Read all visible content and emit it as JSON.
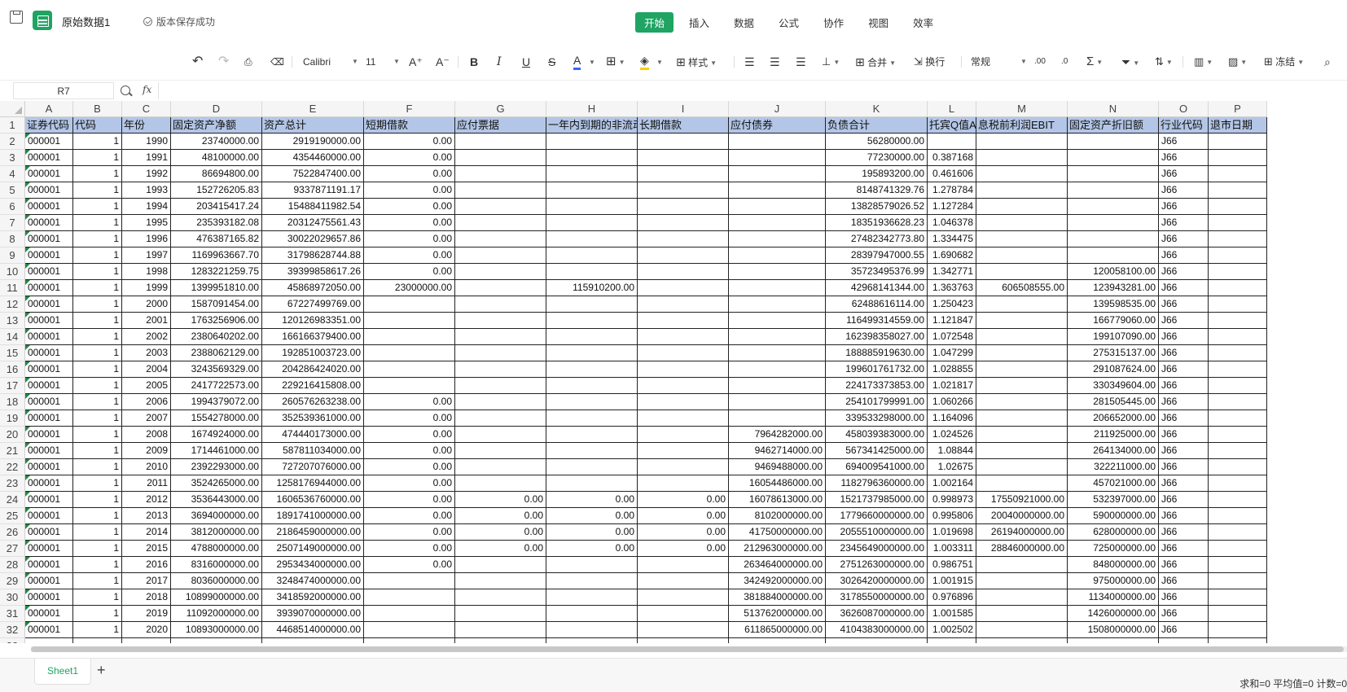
{
  "titlebar": {
    "doc_title": "原始数据1",
    "save_status": "版本保存成功",
    "menu_tabs": [
      "开始",
      "插入",
      "数据",
      "公式",
      "协作",
      "视图",
      "效率"
    ],
    "active_tab": "开始"
  },
  "toolbar": {
    "font_name": "Calibri",
    "font_size": "11",
    "bold": "B",
    "italic": "I",
    "underline": "U",
    "strike": "S",
    "font_color": "A",
    "style_label": "样式",
    "merge_label": "合并",
    "wrap_label": "换行",
    "number_format": "常规",
    "freeze_label": "冻结",
    "icons": [
      "undo-icon",
      "redo-icon",
      "format-painter-icon",
      "eraser-icon",
      "increase-font-icon",
      "decrease-font-icon",
      "border-icon",
      "fill-color-icon",
      "align-left-icon",
      "align-center-icon",
      "align-right-icon",
      "valign-icon",
      "increase-decimal-icon",
      "decrease-decimal-icon",
      "sum-icon",
      "filter-icon",
      "sort-icon",
      "chart-icon",
      "image-icon",
      "search-icon"
    ]
  },
  "formula_bar": {
    "name_box": "R7",
    "fx": "fx",
    "value": ""
  },
  "grid": {
    "columns": [
      "A",
      "B",
      "C",
      "D",
      "E",
      "F",
      "G",
      "H",
      "I",
      "J",
      "K",
      "L",
      "M",
      "N",
      "O",
      "P"
    ],
    "row_numbers": [
      "1",
      "2",
      "3",
      "4",
      "5",
      "6",
      "7",
      "8",
      "9",
      "10",
      "11",
      "12",
      "13",
      "14",
      "15",
      "16",
      "17",
      "18",
      "19",
      "20",
      "21",
      "22",
      "23",
      "24",
      "25",
      "26",
      "27",
      "28",
      "29",
      "30",
      "31",
      "32",
      "33"
    ],
    "header_row": [
      "证券代码",
      "代码",
      "年份",
      "固定资产净额",
      "资产总计",
      "短期借款",
      "应付票据",
      "一年内到期的非流动负债",
      "长期借款",
      "应付债券",
      "负债合计",
      "托宾Q值A",
      "息税前利润EBIT",
      "固定资产折旧额",
      "行业代码",
      "退市日期"
    ],
    "data_rows": [
      [
        "000001",
        "1",
        "1990",
        "23740000.00",
        "2919190000.00",
        "0.00",
        "",
        "",
        "",
        "",
        "56280000.00",
        "",
        "",
        "",
        "J66",
        ""
      ],
      [
        "000001",
        "1",
        "1991",
        "48100000.00",
        "4354460000.00",
        "0.00",
        "",
        "",
        "",
        "",
        "77230000.00",
        "0.387168",
        "",
        "",
        "J66",
        ""
      ],
      [
        "000001",
        "1",
        "1992",
        "86694800.00",
        "7522847400.00",
        "0.00",
        "",
        "",
        "",
        "",
        "195893200.00",
        "0.461606",
        "",
        "",
        "J66",
        ""
      ],
      [
        "000001",
        "1",
        "1993",
        "152726205.83",
        "9337871191.17",
        "0.00",
        "",
        "",
        "",
        "",
        "8148741329.76",
        "1.278784",
        "",
        "",
        "J66",
        ""
      ],
      [
        "000001",
        "1",
        "1994",
        "203415417.24",
        "15488411982.54",
        "0.00",
        "",
        "",
        "",
        "",
        "13828579026.52",
        "1.127284",
        "",
        "",
        "J66",
        ""
      ],
      [
        "000001",
        "1",
        "1995",
        "235393182.08",
        "20312475561.43",
        "0.00",
        "",
        "",
        "",
        "",
        "18351936628.23",
        "1.046378",
        "",
        "",
        "J66",
        ""
      ],
      [
        "000001",
        "1",
        "1996",
        "476387165.82",
        "30022029657.86",
        "0.00",
        "",
        "",
        "",
        "",
        "27482342773.80",
        "1.334475",
        "",
        "",
        "J66",
        ""
      ],
      [
        "000001",
        "1",
        "1997",
        "1169963667.70",
        "31798628744.88",
        "0.00",
        "",
        "",
        "",
        "",
        "28397947000.55",
        "1.690682",
        "",
        "",
        "J66",
        ""
      ],
      [
        "000001",
        "1",
        "1998",
        "1283221259.75",
        "39399858617.26",
        "0.00",
        "",
        "",
        "",
        "",
        "35723495376.99",
        "1.342771",
        "",
        "120058100.00",
        "J66",
        ""
      ],
      [
        "000001",
        "1",
        "1999",
        "1399951810.00",
        "45868972050.00",
        "23000000.00",
        "",
        "115910200.00",
        "",
        "",
        "42968141344.00",
        "1.363763",
        "606508555.00",
        "123943281.00",
        "J66",
        ""
      ],
      [
        "000001",
        "1",
        "2000",
        "1587091454.00",
        "67227499769.00",
        "",
        "",
        "",
        "",
        "",
        "62488616114.00",
        "1.250423",
        "",
        "139598535.00",
        "J66",
        ""
      ],
      [
        "000001",
        "1",
        "2001",
        "1763256906.00",
        "120126983351.00",
        "",
        "",
        "",
        "",
        "",
        "116499314559.00",
        "1.121847",
        "",
        "166779060.00",
        "J66",
        ""
      ],
      [
        "000001",
        "1",
        "2002",
        "2380640202.00",
        "166166379400.00",
        "",
        "",
        "",
        "",
        "",
        "162398358027.00",
        "1.072548",
        "",
        "199107090.00",
        "J66",
        ""
      ],
      [
        "000001",
        "1",
        "2003",
        "2388062129.00",
        "192851003723.00",
        "",
        "",
        "",
        "",
        "",
        "188885919630.00",
        "1.047299",
        "",
        "275315137.00",
        "J66",
        ""
      ],
      [
        "000001",
        "1",
        "2004",
        "3243569329.00",
        "204286424020.00",
        "",
        "",
        "",
        "",
        "",
        "199601761732.00",
        "1.028855",
        "",
        "291087624.00",
        "J66",
        ""
      ],
      [
        "000001",
        "1",
        "2005",
        "2417722573.00",
        "229216415808.00",
        "",
        "",
        "",
        "",
        "",
        "224173373853.00",
        "1.021817",
        "",
        "330349604.00",
        "J66",
        ""
      ],
      [
        "000001",
        "1",
        "2006",
        "1994379072.00",
        "260576263238.00",
        "0.00",
        "",
        "",
        "",
        "",
        "254101799991.00",
        "1.060266",
        "",
        "281505445.00",
        "J66",
        ""
      ],
      [
        "000001",
        "1",
        "2007",
        "1554278000.00",
        "352539361000.00",
        "0.00",
        "",
        "",
        "",
        "",
        "339533298000.00",
        "1.164096",
        "",
        "206652000.00",
        "J66",
        ""
      ],
      [
        "000001",
        "1",
        "2008",
        "1674924000.00",
        "474440173000.00",
        "0.00",
        "",
        "",
        "",
        "7964282000.00",
        "458039383000.00",
        "1.024526",
        "",
        "211925000.00",
        "J66",
        ""
      ],
      [
        "000001",
        "1",
        "2009",
        "1714461000.00",
        "587811034000.00",
        "0.00",
        "",
        "",
        "",
        "9462714000.00",
        "567341425000.00",
        "1.08844",
        "",
        "264134000.00",
        "J66",
        ""
      ],
      [
        "000001",
        "1",
        "2010",
        "2392293000.00",
        "727207076000.00",
        "0.00",
        "",
        "",
        "",
        "9469488000.00",
        "694009541000.00",
        "1.02675",
        "",
        "322211000.00",
        "J66",
        ""
      ],
      [
        "000001",
        "1",
        "2011",
        "3524265000.00",
        "1258176944000.00",
        "0.00",
        "",
        "",
        "",
        "16054486000.00",
        "1182796360000.00",
        "1.002164",
        "",
        "457021000.00",
        "J66",
        ""
      ],
      [
        "000001",
        "1",
        "2012",
        "3536443000.00",
        "1606536760000.00",
        "0.00",
        "0.00",
        "0.00",
        "0.00",
        "16078613000.00",
        "1521737985000.00",
        "0.998973",
        "17550921000.00",
        "532397000.00",
        "J66",
        ""
      ],
      [
        "000001",
        "1",
        "2013",
        "3694000000.00",
        "1891741000000.00",
        "0.00",
        "0.00",
        "0.00",
        "0.00",
        "8102000000.00",
        "1779660000000.00",
        "0.995806",
        "20040000000.00",
        "590000000.00",
        "J66",
        ""
      ],
      [
        "000001",
        "1",
        "2014",
        "3812000000.00",
        "2186459000000.00",
        "0.00",
        "0.00",
        "0.00",
        "0.00",
        "41750000000.00",
        "2055510000000.00",
        "1.019698",
        "26194000000.00",
        "628000000.00",
        "J66",
        ""
      ],
      [
        "000001",
        "1",
        "2015",
        "4788000000.00",
        "2507149000000.00",
        "0.00",
        "0.00",
        "0.00",
        "0.00",
        "212963000000.00",
        "2345649000000.00",
        "1.003311",
        "28846000000.00",
        "725000000.00",
        "J66",
        ""
      ],
      [
        "000001",
        "1",
        "2016",
        "8316000000.00",
        "2953434000000.00",
        "0.00",
        "",
        "",
        "",
        "263464000000.00",
        "2751263000000.00",
        "0.986751",
        "",
        "848000000.00",
        "J66",
        ""
      ],
      [
        "000001",
        "1",
        "2017",
        "8036000000.00",
        "3248474000000.00",
        "",
        "",
        "",
        "",
        "342492000000.00",
        "3026420000000.00",
        "1.001915",
        "",
        "975000000.00",
        "J66",
        ""
      ],
      [
        "000001",
        "1",
        "2018",
        "10899000000.00",
        "3418592000000.00",
        "",
        "",
        "",
        "",
        "381884000000.00",
        "3178550000000.00",
        "0.976896",
        "",
        "1134000000.00",
        "J66",
        ""
      ],
      [
        "000001",
        "1",
        "2019",
        "11092000000.00",
        "3939070000000.00",
        "",
        "",
        "",
        "",
        "513762000000.00",
        "3626087000000.00",
        "1.001585",
        "",
        "1426000000.00",
        "J66",
        ""
      ],
      [
        "000001",
        "1",
        "2020",
        "10893000000.00",
        "4468514000000.00",
        "",
        "",
        "",
        "",
        "611865000000.00",
        "4104383000000.00",
        "1.002502",
        "",
        "1508000000.00",
        "J66",
        ""
      ],
      [
        "",
        "",
        "",
        "",
        "",
        "",
        "",
        "",
        "",
        "",
        "",
        "",
        "",
        "",
        "",
        ""
      ]
    ]
  },
  "bottom": {
    "sheet_tab": "Sheet1",
    "add_sheet": "+",
    "status": "求和=0 平均值=0 计数=0"
  },
  "colors": {
    "accent": "#1fa463",
    "header_fill": "#b4c6e7"
  }
}
